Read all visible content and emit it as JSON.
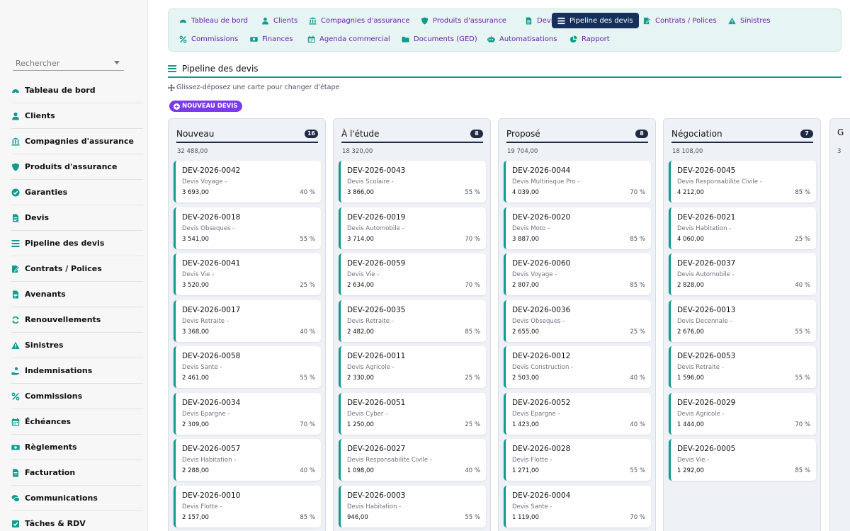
{
  "colors": {
    "accent": "#0f9b8e",
    "active_tab": "#15305b",
    "tab_text": "#6b21a8",
    "primary_button": "#7c3aed"
  },
  "search": {
    "placeholder": "Rechercher"
  },
  "sidebar": {
    "items": [
      {
        "label": "Tableau de bord",
        "icon": "dashboard-icon"
      },
      {
        "label": "Clients",
        "icon": "user-icon"
      },
      {
        "label": "Compagnies d'assurance",
        "icon": "bank-icon"
      },
      {
        "label": "Produits d'assurance",
        "icon": "shield-icon"
      },
      {
        "label": "Garanties",
        "icon": "check-circle-icon"
      },
      {
        "label": "Devis",
        "icon": "document-icon"
      },
      {
        "label": "Pipeline des devis",
        "icon": "bars-icon"
      },
      {
        "label": "Contrats / Polices",
        "icon": "contract-icon"
      },
      {
        "label": "Avenants",
        "icon": "document-icon"
      },
      {
        "label": "Renouvellements",
        "icon": "refresh-icon"
      },
      {
        "label": "Sinistres",
        "icon": "warning-icon"
      },
      {
        "label": "Indemnisations",
        "icon": "hand-coin-icon"
      },
      {
        "label": "Commissions",
        "icon": "percent-icon"
      },
      {
        "label": "Échéances",
        "icon": "calendar-icon"
      },
      {
        "label": "Règlements",
        "icon": "money-icon"
      },
      {
        "label": "Facturation",
        "icon": "invoice-icon"
      },
      {
        "label": "Communications",
        "icon": "chat-icon"
      },
      {
        "label": "Tâches & RDV",
        "icon": "tasks-icon"
      }
    ]
  },
  "tabs": [
    {
      "label": "Tableau de bord",
      "icon": "dashboard-icon"
    },
    {
      "label": "Clients",
      "icon": "user-icon"
    },
    {
      "label": "Compagnies d'assurance",
      "icon": "bank-icon"
    },
    {
      "label": "Produits d'assurance",
      "icon": "shield-icon"
    },
    {
      "label": "Devis",
      "icon": "document-icon"
    },
    {
      "label": "Pipeline des devis",
      "icon": "bars-icon",
      "active": true
    },
    {
      "label": "Contrats / Polices",
      "icon": "contract-icon"
    },
    {
      "label": "Sinistres",
      "icon": "warning-icon"
    },
    {
      "label": "Commissions",
      "icon": "percent-icon"
    },
    {
      "label": "Finances",
      "icon": "money-icon"
    },
    {
      "label": "Agenda commercial",
      "icon": "calendar-icon"
    },
    {
      "label": "Documents (GED)",
      "icon": "folder-icon"
    },
    {
      "label": "Automatisations",
      "icon": "robot-icon"
    },
    {
      "label": "Rapport",
      "icon": "pie-icon"
    }
  ],
  "page": {
    "title": "Pipeline des devis",
    "hint": "Glissez-déposez une carte pour changer d'étape",
    "new_button": "NOUVEAU DEVIS"
  },
  "columns": [
    {
      "title": "Nouveau",
      "count": "16",
      "total": "32 488,00",
      "cards": [
        {
          "ref": "DEV-2026-0042",
          "type": "Devis Voyage -",
          "amount": "3 693,00",
          "pct": "40 %"
        },
        {
          "ref": "DEV-2026-0018",
          "type": "Devis Obseques -",
          "amount": "3 541,00",
          "pct": "55 %"
        },
        {
          "ref": "DEV-2026-0041",
          "type": "Devis Vie -",
          "amount": "3 520,00",
          "pct": "25 %"
        },
        {
          "ref": "DEV-2026-0017",
          "type": "Devis Retraite -",
          "amount": "3 368,00",
          "pct": "40 %"
        },
        {
          "ref": "DEV-2026-0058",
          "type": "Devis Sante -",
          "amount": "2 461,00",
          "pct": "55 %"
        },
        {
          "ref": "DEV-2026-0034",
          "type": "Devis Epargne -",
          "amount": "2 309,00",
          "pct": "70 %"
        },
        {
          "ref": "DEV-2026-0057",
          "type": "Devis Habitation -",
          "amount": "2 288,00",
          "pct": "40 %"
        },
        {
          "ref": "DEV-2026-0010",
          "type": "Devis Flotte -",
          "amount": "2 157,00",
          "pct": "85 %"
        }
      ]
    },
    {
      "title": "À l'étude",
      "count": "8",
      "total": "18 320,00",
      "cards": [
        {
          "ref": "DEV-2026-0043",
          "type": "Devis Scolaire -",
          "amount": "3 866,00",
          "pct": "55 %"
        },
        {
          "ref": "DEV-2026-0019",
          "type": "Devis Automobile -",
          "amount": "3 714,00",
          "pct": "70 %"
        },
        {
          "ref": "DEV-2026-0059",
          "type": "Devis Vie -",
          "amount": "2 634,00",
          "pct": "70 %"
        },
        {
          "ref": "DEV-2026-0035",
          "type": "Devis Retraite -",
          "amount": "2 482,00",
          "pct": "85 %"
        },
        {
          "ref": "DEV-2026-0011",
          "type": "Devis Agricole -",
          "amount": "2 330,00",
          "pct": "25 %"
        },
        {
          "ref": "DEV-2026-0051",
          "type": "Devis Cyber -",
          "amount": "1 250,00",
          "pct": "25 %"
        },
        {
          "ref": "DEV-2026-0027",
          "type": "Devis Responsabilite Civile -",
          "amount": "1 098,00",
          "pct": "40 %"
        },
        {
          "ref": "DEV-2026-0003",
          "type": "Devis Habitation -",
          "amount": "946,00",
          "pct": "55 %"
        }
      ]
    },
    {
      "title": "Proposé",
      "count": "8",
      "total": "19 704,00",
      "cards": [
        {
          "ref": "DEV-2026-0044",
          "type": "Devis Multirisque Pro -",
          "amount": "4 039,00",
          "pct": "70 %"
        },
        {
          "ref": "DEV-2026-0020",
          "type": "Devis Moto -",
          "amount": "3 887,00",
          "pct": "85 %"
        },
        {
          "ref": "DEV-2026-0060",
          "type": "Devis Voyage -",
          "amount": "2 807,00",
          "pct": "85 %"
        },
        {
          "ref": "DEV-2026-0036",
          "type": "Devis Obseques -",
          "amount": "2 655,00",
          "pct": "25 %"
        },
        {
          "ref": "DEV-2026-0012",
          "type": "Devis Construction -",
          "amount": "2 503,00",
          "pct": "40 %"
        },
        {
          "ref": "DEV-2026-0052",
          "type": "Devis Epargne -",
          "amount": "1 423,00",
          "pct": "40 %"
        },
        {
          "ref": "DEV-2026-0028",
          "type": "Devis Flotte -",
          "amount": "1 271,00",
          "pct": "55 %"
        },
        {
          "ref": "DEV-2026-0004",
          "type": "Devis Sante -",
          "amount": "1 119,00",
          "pct": "70 %"
        }
      ]
    },
    {
      "title": "Négociation",
      "count": "7",
      "total": "18 108,00",
      "cards": [
        {
          "ref": "DEV-2026-0045",
          "type": "Devis Responsabilite Civile -",
          "amount": "4 212,00",
          "pct": "85 %"
        },
        {
          "ref": "DEV-2026-0021",
          "type": "Devis Habitation -",
          "amount": "4 060,00",
          "pct": "25 %"
        },
        {
          "ref": "DEV-2026-0037",
          "type": "Devis Automobile -",
          "amount": "2 828,00",
          "pct": "40 %"
        },
        {
          "ref": "DEV-2026-0013",
          "type": "Devis Decennale -",
          "amount": "2 676,00",
          "pct": "55 %"
        },
        {
          "ref": "DEV-2026-0053",
          "type": "Devis Retraite -",
          "amount": "1 596,00",
          "pct": "55 %"
        },
        {
          "ref": "DEV-2026-0029",
          "type": "Devis Agricole -",
          "amount": "1 444,00",
          "pct": "70 %"
        },
        {
          "ref": "DEV-2026-0005",
          "type": "Devis Vie -",
          "amount": "1 292,00",
          "pct": "85 %"
        }
      ]
    }
  ],
  "peek_column": {
    "title": "G",
    "total": "3"
  }
}
